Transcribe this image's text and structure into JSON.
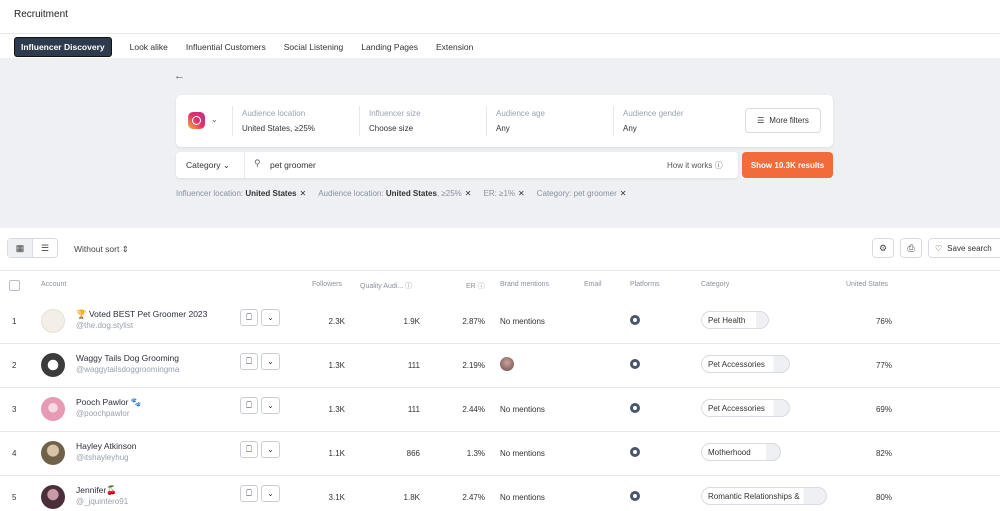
{
  "app": {
    "title": "Recruitment"
  },
  "tabs": [
    {
      "label": "Influencer Discovery",
      "active": true
    },
    {
      "label": "Look alike"
    },
    {
      "label": "Influential Customers"
    },
    {
      "label": "Social Listening"
    },
    {
      "label": "Landing Pages"
    },
    {
      "label": "Extension"
    }
  ],
  "filters": {
    "audience_location": {
      "label": "Audience location",
      "value": "United States, ≥25%"
    },
    "influencer_size": {
      "label": "Influencer size",
      "value": "Choose size"
    },
    "audience_age": {
      "label": "Audience age",
      "value": "Any"
    },
    "audience_gender": {
      "label": "Audience gender",
      "value": "Any"
    },
    "more_filters": "More filters"
  },
  "search": {
    "category_label": "Category",
    "value": "pet groomer",
    "how_it_works": "How it works",
    "show_results": "Show 10.3K results"
  },
  "chips": [
    {
      "prefix": "Influencer location: ",
      "bold": "United States"
    },
    {
      "prefix": "Audience location: ",
      "bold": "United States",
      "suffix": ", ≥25%"
    },
    {
      "prefix": "ER: ≥1%"
    },
    {
      "prefix": "Category: pet groomer"
    }
  ],
  "toolbar": {
    "sort": "Without sort",
    "save_search": "Save search"
  },
  "table": {
    "headers": {
      "account": "Account",
      "followers": "Followers",
      "quality": "Quality Audi...",
      "er": "ER",
      "brand_mentions": "Brand mentions",
      "email": "Email",
      "platforms": "Platforms",
      "category": "Category",
      "country": "United States"
    },
    "rows": [
      {
        "num": "1",
        "name": "🏆 Voted BEST Pet Groomer 2023",
        "handle": "@the.dog.stylist",
        "followers": "2.3K",
        "quality": "1.9K",
        "er": "2.87%",
        "mentions": "No mentions",
        "category": "Pet Health",
        "pct": "76%",
        "avatar_color": "#f3efe6"
      },
      {
        "num": "2",
        "name": "Waggy Tails Dog Grooming",
        "handle": "@waggytailsdoggroomingma",
        "followers": "1.3K",
        "quality": "111",
        "er": "2.19%",
        "mentions": "",
        "category": "Pet Accessories",
        "pct": "77%",
        "avatar_color": "#3b3b3b"
      },
      {
        "num": "3",
        "name": "Pooch Pawlor 🐾",
        "handle": "@poochpawlor",
        "followers": "1.3K",
        "quality": "111",
        "er": "2.44%",
        "mentions": "No mentions",
        "category": "Pet Accessories",
        "pct": "69%",
        "avatar_color": "#e79ab3"
      },
      {
        "num": "4",
        "name": "Hayley Atkinson",
        "handle": "@itshayleyhug",
        "followers": "1.1K",
        "quality": "866",
        "er": "1.3%",
        "mentions": "No mentions",
        "category": "Motherhood",
        "pct": "82%",
        "avatar_color": "#8a7a5e"
      },
      {
        "num": "5",
        "name": "Jennifer🍒",
        "handle": "@_jquintero91",
        "followers": "3.1K",
        "quality": "1.8K",
        "er": "2.47%",
        "mentions": "No mentions",
        "category": "Romantic Relationships &",
        "pct": "80%",
        "avatar_color": "#5a3a48"
      }
    ]
  }
}
